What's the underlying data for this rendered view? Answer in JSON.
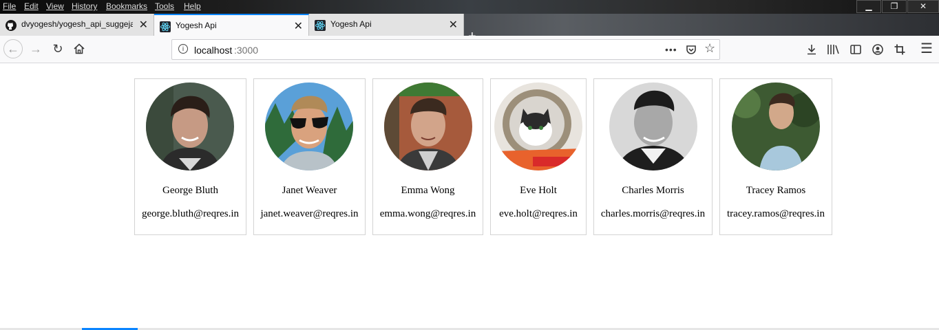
{
  "menubar": {
    "items": [
      "File",
      "Edit",
      "View",
      "History",
      "Bookmarks",
      "Tools",
      "Help"
    ]
  },
  "window_controls": {
    "minimize": "▁",
    "restore": "❐",
    "close": "✕"
  },
  "tabs": [
    {
      "label": "dvyogesh/yogesh_api_suggeja",
      "icon": "github-icon",
      "active": false
    },
    {
      "label": "Yogesh Api",
      "icon": "react-icon",
      "active": true
    },
    {
      "label": "Yogesh Api",
      "icon": "react-icon",
      "active": false
    }
  ],
  "tab_close_glyph": "✕",
  "new_tab_glyph": "+",
  "urlbar": {
    "host": "localhost",
    "port": ":3000"
  },
  "users": [
    {
      "name": "George Bluth",
      "email": "george.bluth@reqres.in"
    },
    {
      "name": "Janet Weaver",
      "email": "janet.weaver@reqres.in"
    },
    {
      "name": "Emma Wong",
      "email": "emma.wong@reqres.in"
    },
    {
      "name": "Eve Holt",
      "email": "eve.holt@reqres.in"
    },
    {
      "name": "Charles Morris",
      "email": "charles.morris@reqres.in"
    },
    {
      "name": "Tracey Ramos",
      "email": "tracey.ramos@reqres.in"
    }
  ],
  "colors": {
    "accent": "#0a84ff",
    "card_border": "#d3d3d3"
  }
}
